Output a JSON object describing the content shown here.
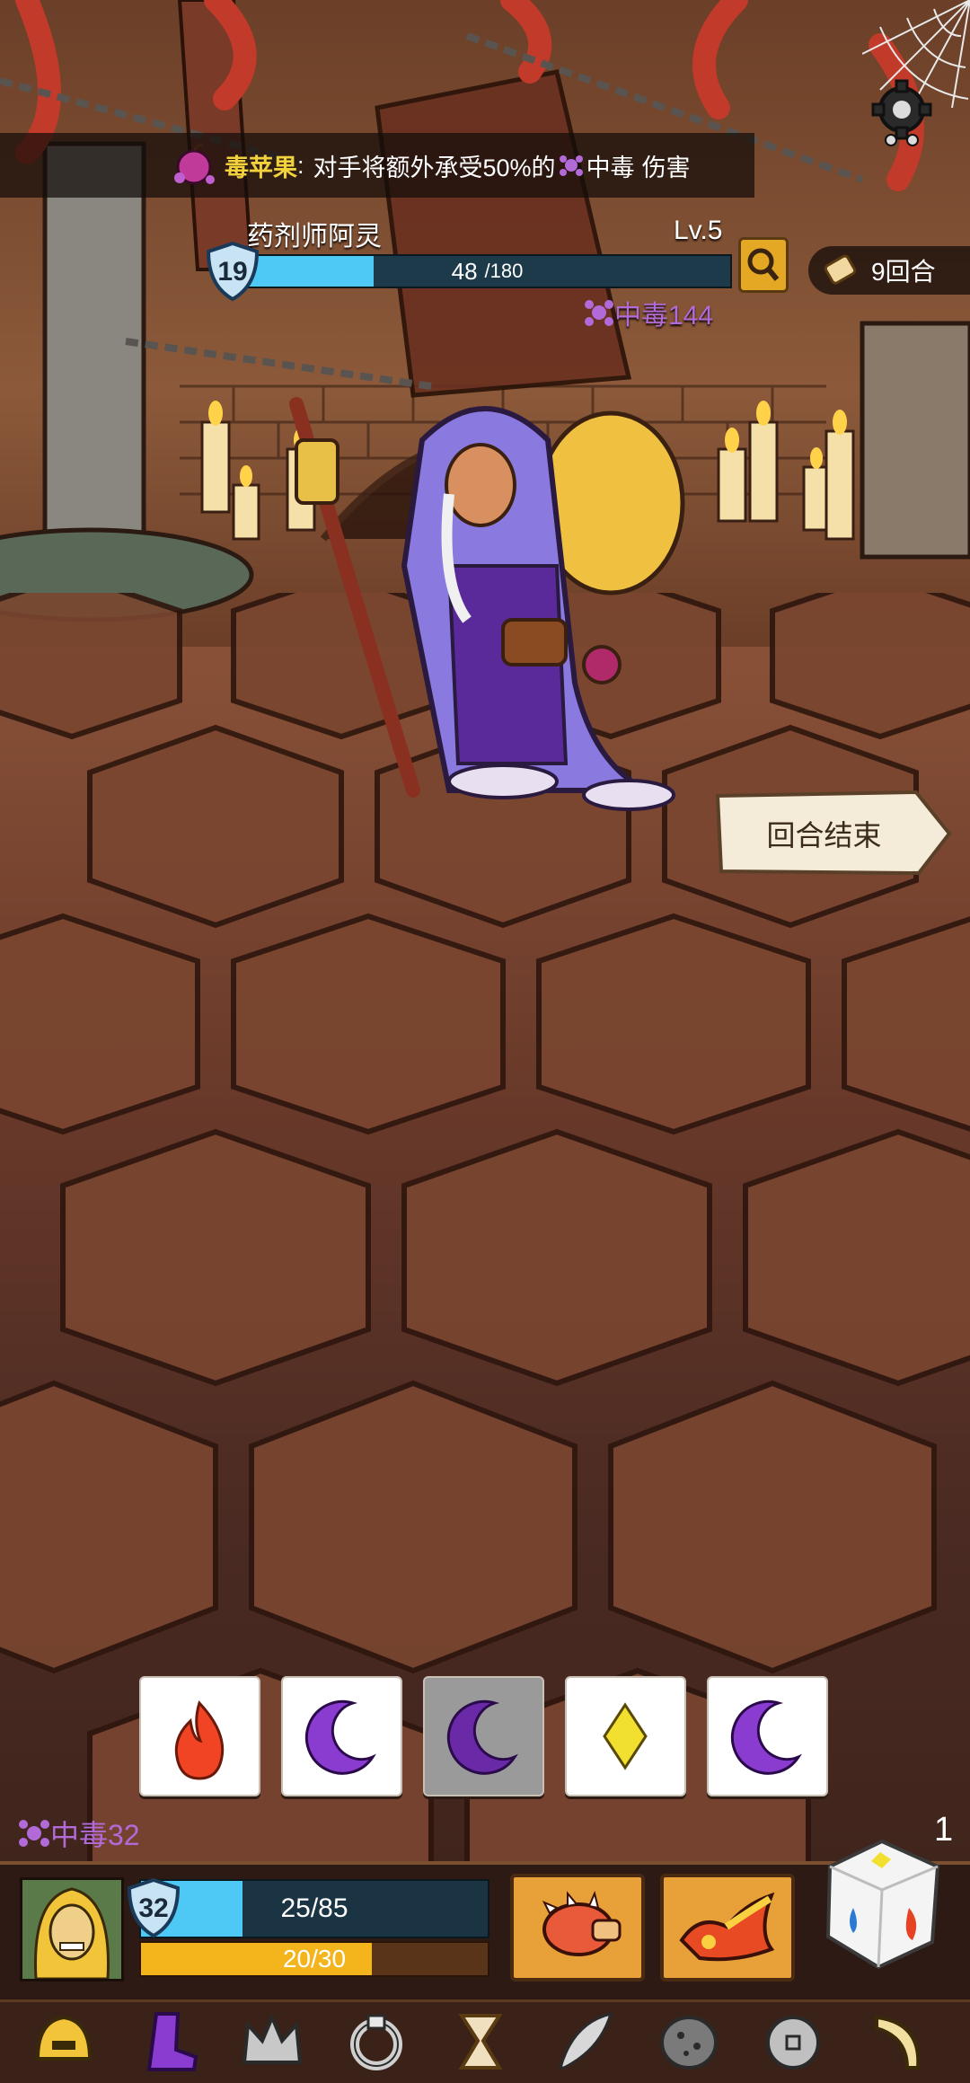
{
  "info_bar": {
    "item_name": "毒苹果",
    "separator": ":",
    "text_before": "对手将额外承受50%的",
    "status_name": "中毒",
    "text_after": "伤害"
  },
  "enemy": {
    "name": "药剂师阿灵",
    "level": "Lv.5",
    "armor": "19",
    "hp_current": "48",
    "hp_max": "/180",
    "hp_fraction": 0.267,
    "status": "中毒144"
  },
  "turns": {
    "label": "9回合"
  },
  "end_turn": {
    "label": "回合结束"
  },
  "dice": [
    {
      "symbol": "fire",
      "color": "#f04424",
      "selected": false
    },
    {
      "symbol": "moon",
      "color": "#8a3cd0",
      "selected": false
    },
    {
      "symbol": "moon",
      "color": "#6a2aa8",
      "selected": true
    },
    {
      "symbol": "diamond",
      "color": "#f2e030",
      "selected": false
    },
    {
      "symbol": "moon",
      "color": "#8a3cd0",
      "selected": false
    }
  ],
  "player": {
    "status": "中毒32",
    "armor": "32",
    "hp": "25/85",
    "hp_fraction": 0.294,
    "energy": "20/30",
    "energy_fraction": 0.667,
    "round_counter": "1"
  },
  "skills": [
    {
      "icon": "spiked-fist-icon"
    },
    {
      "icon": "explosion-icon"
    }
  ],
  "equipment": [
    {
      "icon": "golden-helmet-icon"
    },
    {
      "icon": "purple-boot-icon"
    },
    {
      "icon": "silver-crown-icon"
    },
    {
      "icon": "silver-ring-icon"
    },
    {
      "icon": "hourglass-icon"
    },
    {
      "icon": "feather-icon"
    },
    {
      "icon": "spotted-stone-icon"
    },
    {
      "icon": "silver-coin-icon"
    },
    {
      "icon": "horn-icon"
    }
  ],
  "colors": {
    "hp_blue": "#4ec8f4",
    "energy_yellow": "#f4b41c",
    "poison_purple": "#b36ad9",
    "highlight_yellow": "#f2d23c"
  }
}
